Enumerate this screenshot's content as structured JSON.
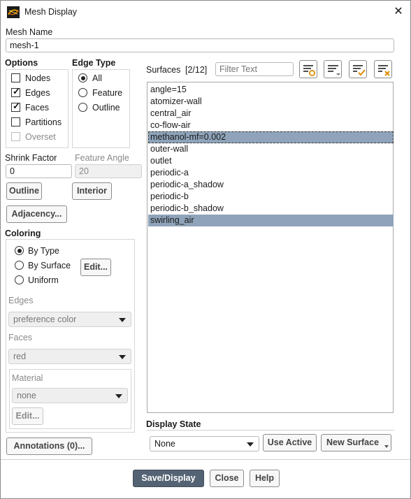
{
  "window": {
    "title": "Mesh Display"
  },
  "mesh_name": {
    "label": "Mesh Name",
    "value": "mesh-1"
  },
  "options": {
    "label": "Options",
    "items": [
      {
        "label": "Nodes",
        "checked": false,
        "enabled": true
      },
      {
        "label": "Edges",
        "checked": true,
        "enabled": true
      },
      {
        "label": "Faces",
        "checked": true,
        "enabled": true
      },
      {
        "label": "Partitions",
        "checked": false,
        "enabled": true
      },
      {
        "label": "Overset",
        "checked": false,
        "enabled": false
      }
    ]
  },
  "edge_type": {
    "label": "Edge Type",
    "items": [
      {
        "label": "All",
        "selected": true
      },
      {
        "label": "Feature",
        "selected": false
      },
      {
        "label": "Outline",
        "selected": false
      }
    ]
  },
  "shrink_factor": {
    "label": "Shrink Factor",
    "value": "0"
  },
  "feature_angle": {
    "label": "Feature Angle",
    "value": "20"
  },
  "buttons": {
    "outline": "Outline",
    "interior": "Interior",
    "adjacency": "Adjacency...",
    "coloring_edit": "Edit...",
    "material_edit": "Edit...",
    "annotations": "Annotations (0)...",
    "use_active": "Use Active",
    "new_surface": "New Surface",
    "save_display": "Save/Display",
    "close": "Close",
    "help": "Help"
  },
  "coloring": {
    "label": "Coloring",
    "items": [
      {
        "label": "By Type",
        "selected": true
      },
      {
        "label": "By Surface",
        "selected": false
      },
      {
        "label": "Uniform",
        "selected": false
      }
    ],
    "edges_label": "Edges",
    "edges_value": "preference color",
    "faces_label": "Faces",
    "faces_value": "red",
    "material_label": "Material",
    "material_value": "none"
  },
  "surfaces": {
    "label": "Surfaces",
    "count": "[2/12]",
    "filter_placeholder": "Filter Text",
    "items": [
      {
        "label": "angle=15",
        "selected": false
      },
      {
        "label": "atomizer-wall",
        "selected": false
      },
      {
        "label": "central_air",
        "selected": false
      },
      {
        "label": "co-flow-air",
        "selected": false
      },
      {
        "label": "methanol-mf=0.002",
        "selected": true
      },
      {
        "label": "outer-wall",
        "selected": false
      },
      {
        "label": "outlet",
        "selected": false
      },
      {
        "label": "periodic-a",
        "selected": false
      },
      {
        "label": "periodic-a_shadow",
        "selected": false
      },
      {
        "label": "periodic-b",
        "selected": false
      },
      {
        "label": "periodic-b_shadow",
        "selected": false
      },
      {
        "label": "swirling_air",
        "selected": true
      }
    ]
  },
  "display_state": {
    "label": "Display State",
    "value": "None"
  },
  "icons": {
    "app": "fluent-app-icon",
    "close": "close-icon",
    "toolbar": [
      "select-by-filter-icon",
      "sort-list-icon",
      "select-all-icon",
      "deselect-all-icon"
    ]
  }
}
